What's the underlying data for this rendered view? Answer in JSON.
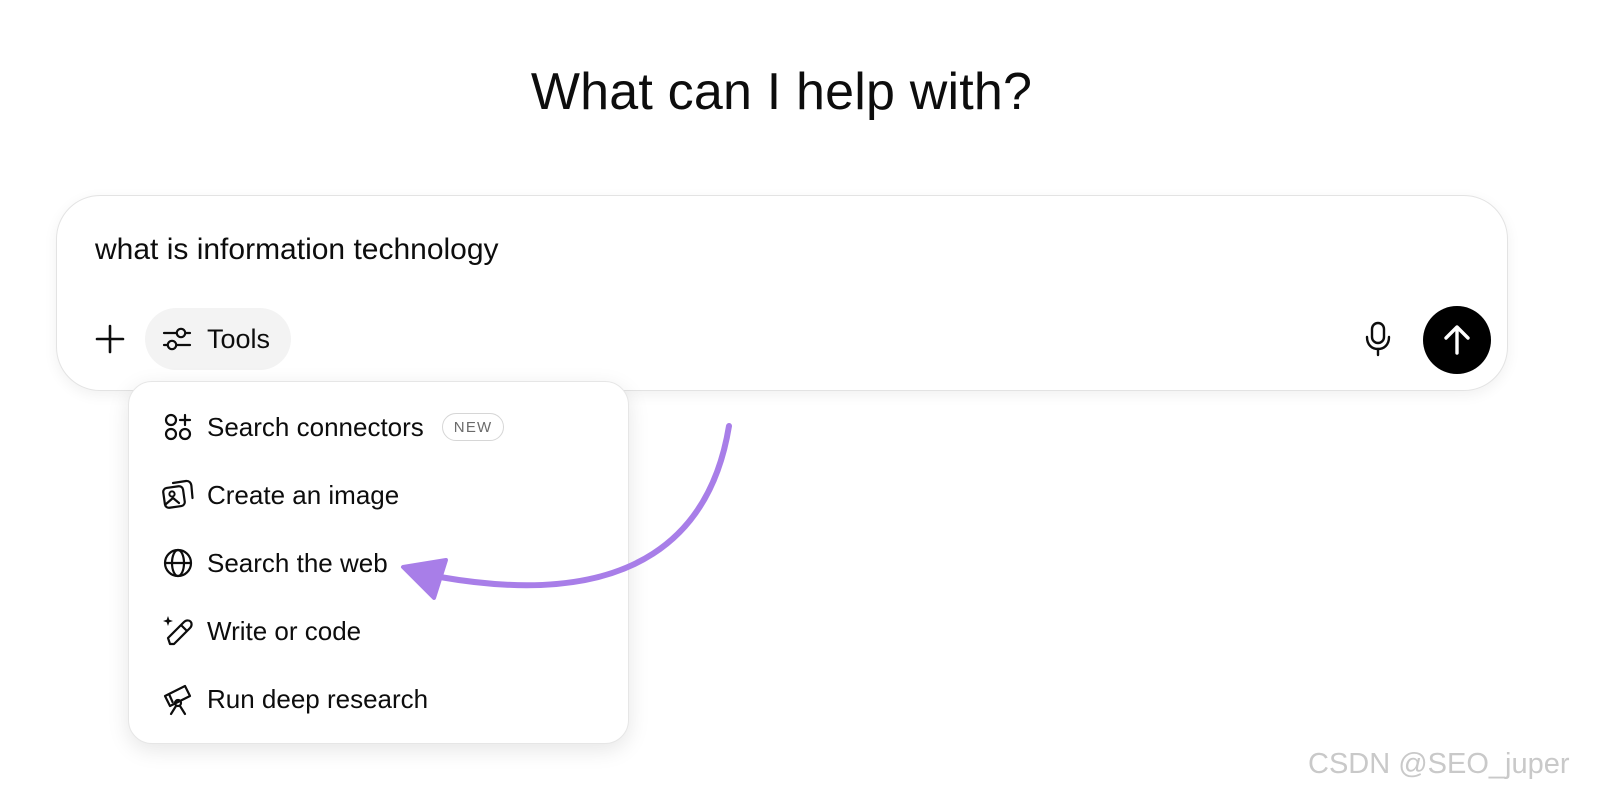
{
  "heading": "What can I help with?",
  "composer": {
    "input_value": "what is information technology",
    "tools_label": "Tools",
    "icons": {
      "add": "plus-icon",
      "tools": "sliders-icon",
      "mic": "microphone-icon",
      "send": "arrow-up-icon"
    }
  },
  "tools_menu": {
    "items": [
      {
        "label": "Search connectors",
        "icon": "connectors-icon",
        "badge": "NEW"
      },
      {
        "label": "Create an image",
        "icon": "image-icon"
      },
      {
        "label": "Search the web",
        "icon": "globe-icon"
      },
      {
        "label": "Write or code",
        "icon": "pencil-sparkle-icon"
      },
      {
        "label": "Run deep research",
        "icon": "telescope-icon"
      }
    ]
  },
  "annotation": {
    "arrow_color": "#a87ee8",
    "points_to": "Search the web"
  },
  "watermark": "CSDN @SEO_juper",
  "colors": {
    "send_button": "#000000",
    "tools_button_bg": "#f3f3f3"
  }
}
